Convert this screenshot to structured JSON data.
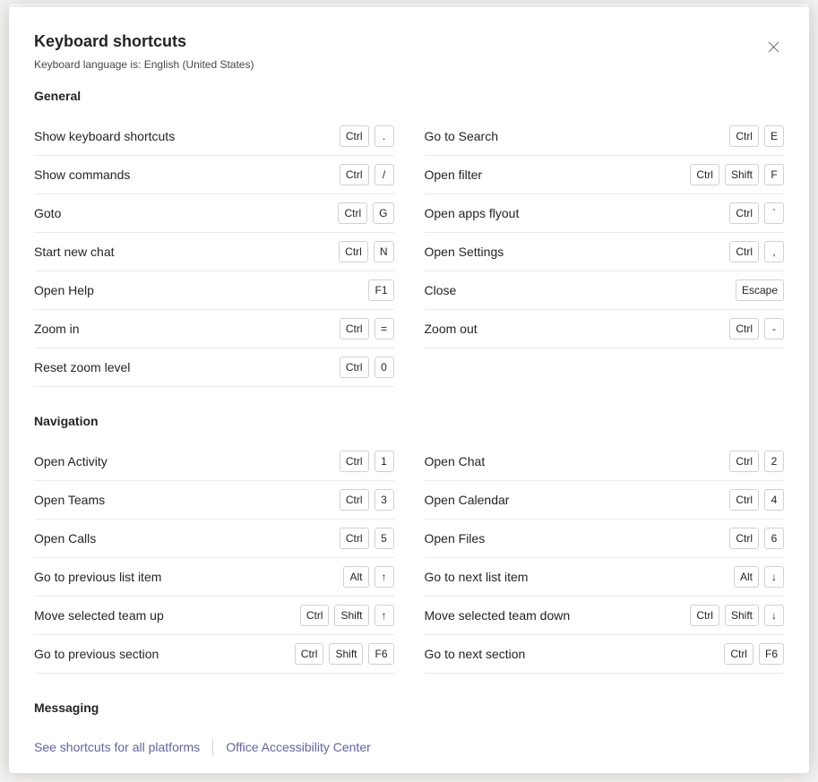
{
  "dialog": {
    "title": "Keyboard shortcuts",
    "subtitle": "Keyboard language is: English (United States)"
  },
  "sections": [
    {
      "title": "General",
      "columns": [
        [
          {
            "label": "Show keyboard shortcuts",
            "keys": [
              "Ctrl",
              "."
            ]
          },
          {
            "label": "Show commands",
            "keys": [
              "Ctrl",
              "/"
            ]
          },
          {
            "label": "Goto",
            "keys": [
              "Ctrl",
              "G"
            ]
          },
          {
            "label": "Start new chat",
            "keys": [
              "Ctrl",
              "N"
            ]
          },
          {
            "label": "Open Help",
            "keys": [
              "F1"
            ]
          },
          {
            "label": "Zoom in",
            "keys": [
              "Ctrl",
              "="
            ]
          },
          {
            "label": "Reset zoom level",
            "keys": [
              "Ctrl",
              "0"
            ]
          }
        ],
        [
          {
            "label": "Go to Search",
            "keys": [
              "Ctrl",
              "E"
            ]
          },
          {
            "label": "Open filter",
            "keys": [
              "Ctrl",
              "Shift",
              "F"
            ]
          },
          {
            "label": "Open apps flyout",
            "keys": [
              "Ctrl",
              "`"
            ]
          },
          {
            "label": "Open Settings",
            "keys": [
              "Ctrl",
              ","
            ]
          },
          {
            "label": "Close",
            "keys": [
              "Escape"
            ]
          },
          {
            "label": "Zoom out",
            "keys": [
              "Ctrl",
              "-"
            ]
          }
        ]
      ]
    },
    {
      "title": "Navigation",
      "columns": [
        [
          {
            "label": "Open Activity",
            "keys": [
              "Ctrl",
              "1"
            ]
          },
          {
            "label": "Open Teams",
            "keys": [
              "Ctrl",
              "3"
            ]
          },
          {
            "label": "Open Calls",
            "keys": [
              "Ctrl",
              "5"
            ]
          },
          {
            "label": "Go to previous list item",
            "keys": [
              "Alt",
              "↑"
            ]
          },
          {
            "label": "Move selected team up",
            "keys": [
              "Ctrl",
              "Shift",
              "↑"
            ]
          },
          {
            "label": "Go to previous section",
            "keys": [
              "Ctrl",
              "Shift",
              "F6"
            ]
          }
        ],
        [
          {
            "label": "Open Chat",
            "keys": [
              "Ctrl",
              "2"
            ]
          },
          {
            "label": "Open Calendar",
            "keys": [
              "Ctrl",
              "4"
            ]
          },
          {
            "label": "Open Files",
            "keys": [
              "Ctrl",
              "6"
            ]
          },
          {
            "label": "Go to next list item",
            "keys": [
              "Alt",
              "↓"
            ]
          },
          {
            "label": "Move selected team down",
            "keys": [
              "Ctrl",
              "Shift",
              "↓"
            ]
          },
          {
            "label": "Go to next section",
            "keys": [
              "Ctrl",
              "F6"
            ]
          }
        ]
      ]
    },
    {
      "title": "Messaging",
      "columns": [
        [],
        []
      ]
    }
  ],
  "footer": {
    "link1": "See shortcuts for all platforms",
    "link2": "Office Accessibility Center"
  }
}
